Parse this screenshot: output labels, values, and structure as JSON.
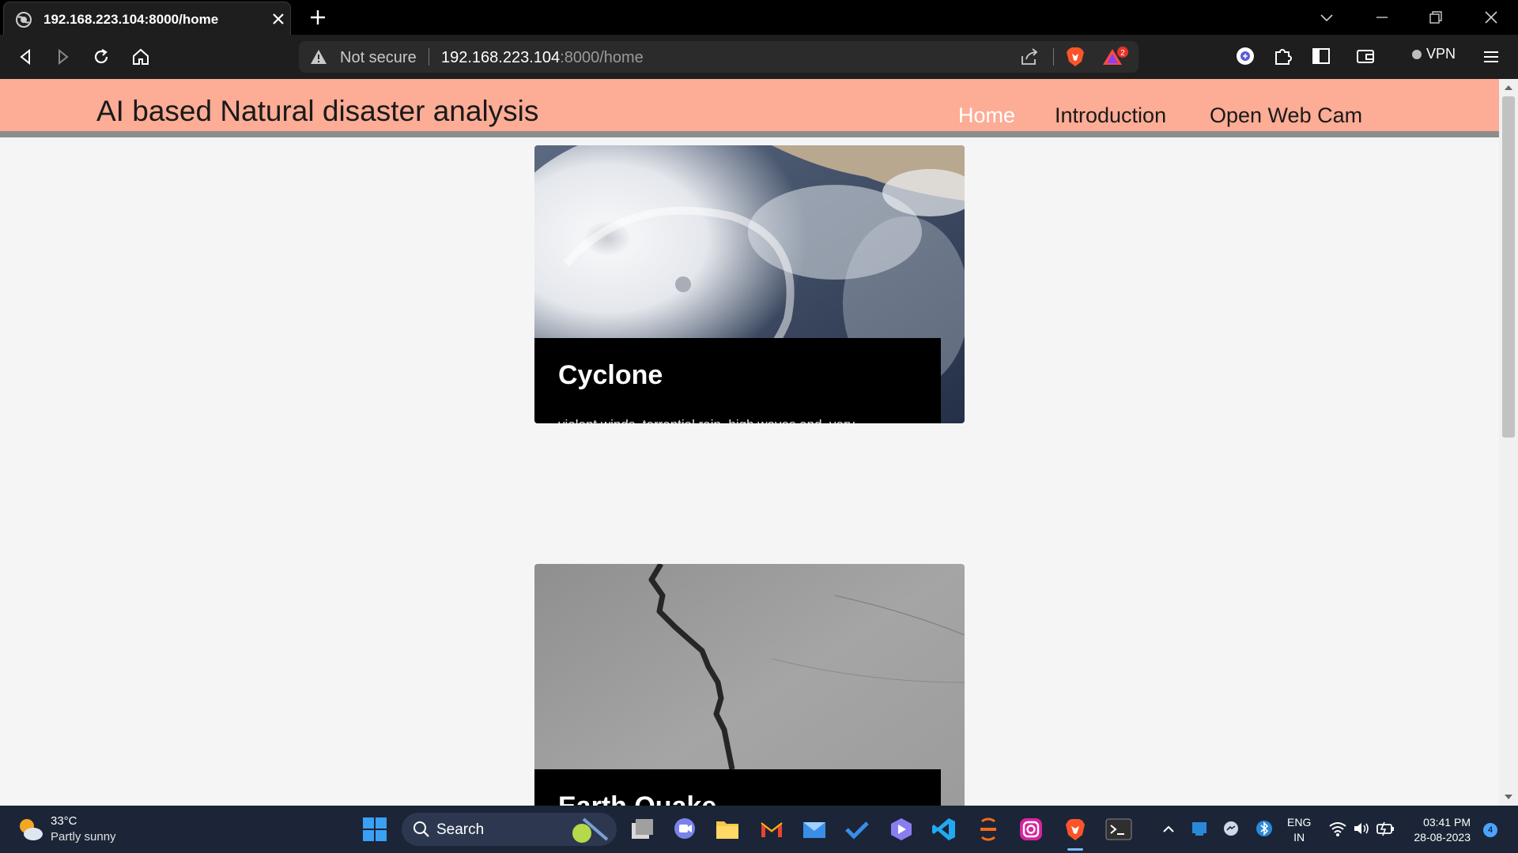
{
  "browser": {
    "tab_title": "192.168.223.104:8000/home",
    "security_label": "Not secure",
    "url_host": "192.168.223.104",
    "url_path": ":8000/home",
    "rewards_badge": "2",
    "vpn_label": "VPN"
  },
  "site": {
    "title": "AI based Natural disaster analysis",
    "nav": {
      "home": "Home",
      "introduction": "Introduction",
      "webcam": "Open Web Cam"
    },
    "active_nav": "Home",
    "colors": {
      "navbar": "#fdac95",
      "navbar_border": "#8d8d8d",
      "page_bg": "#f5f5f5",
      "caption_bg": "#000000"
    }
  },
  "cards": [
    {
      "title": "Cyclone",
      "description": "violent winds, torrential rain, high waves and, very destructive storm"
    },
    {
      "title": "Earth Quake",
      "description": ""
    }
  ],
  "taskbar": {
    "weather_temp": "33°C",
    "weather_desc": "Partly sunny",
    "search_label": "Search",
    "lang_line1": "ENG",
    "lang_line2": "IN",
    "time": "03:41 PM",
    "date": "28-08-2023",
    "notification_count": "4",
    "icons": [
      "weather-icon",
      "windows-start-icon",
      "search-icon",
      "task-view-icon",
      "teams-chat-icon",
      "file-explorer-icon",
      "gmail-icon",
      "mail-icon",
      "todo-icon",
      "power-automate-icon",
      "vscode-icon",
      "app-icon",
      "instagram-icon",
      "brave-icon",
      "terminal-icon"
    ]
  }
}
